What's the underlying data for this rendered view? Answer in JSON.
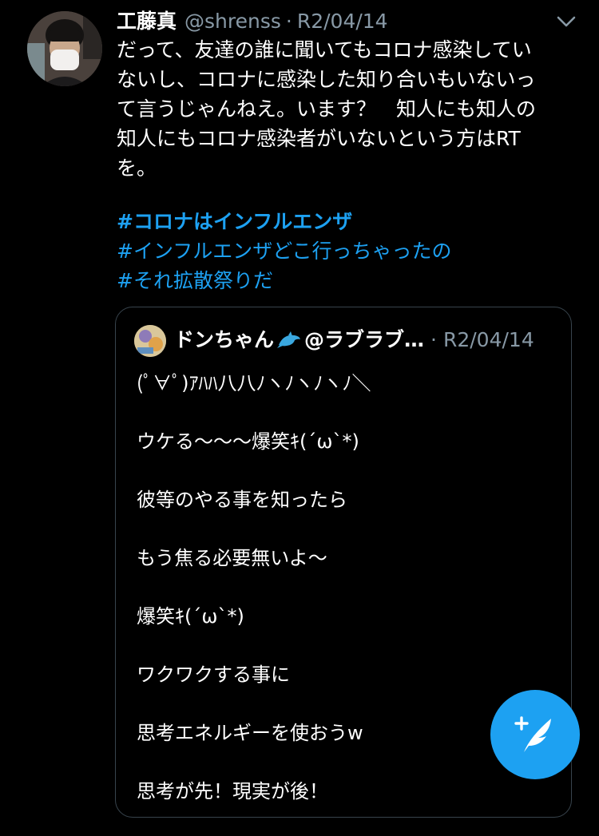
{
  "tweet": {
    "author_name": "工藤真",
    "handle": "@shrenss",
    "separator": "·",
    "date": "R2/04/14",
    "text_lines": [
      "だって、友達の誰に聞いてもコロナ感染してい",
      "ないし、コロナに感染した知り合いもいないっ",
      "て言うじゃんねえ。います？　知人にも知人の",
      "知人にもコロナ感染者がいないという方はRT",
      "を。"
    ],
    "hashtags": [
      "#コロナはインフルエンザ",
      "#インフルエンザどこ行っちゃったの",
      "#それ拡散祭りだ"
    ],
    "menu_icon": "chevron-down-icon",
    "avatar_icon": "profile-photo"
  },
  "quoted_tweet": {
    "author_name": "ドンちゃん",
    "emoji_icon": "dolphin-icon",
    "handle": "@ラブラブ…",
    "separator": "·",
    "date": "R2/04/14",
    "lines": [
      "(ﾟ∀ﾟ)ｱﾊﾊ八八ﾉヽﾉヽﾉヽﾉ＼",
      "ウケる〜〜〜爆笑ｷ(´ω`*)",
      "彼等のやる事を知ったら",
      "もう焦る必要無いよ〜",
      "爆笑ｷ(´ω`*)",
      "ワクワクする事に",
      "思考エネルギーを使おうw",
      "思考が先！現実が後！"
    ]
  },
  "compose_button": {
    "icon": "compose-tweet-icon"
  },
  "colors": {
    "background": "#000000",
    "text": "#ffffff",
    "muted": "#8899a6",
    "link": "#1da1f2",
    "border": "#38444d",
    "fab": "#1da1f2"
  }
}
